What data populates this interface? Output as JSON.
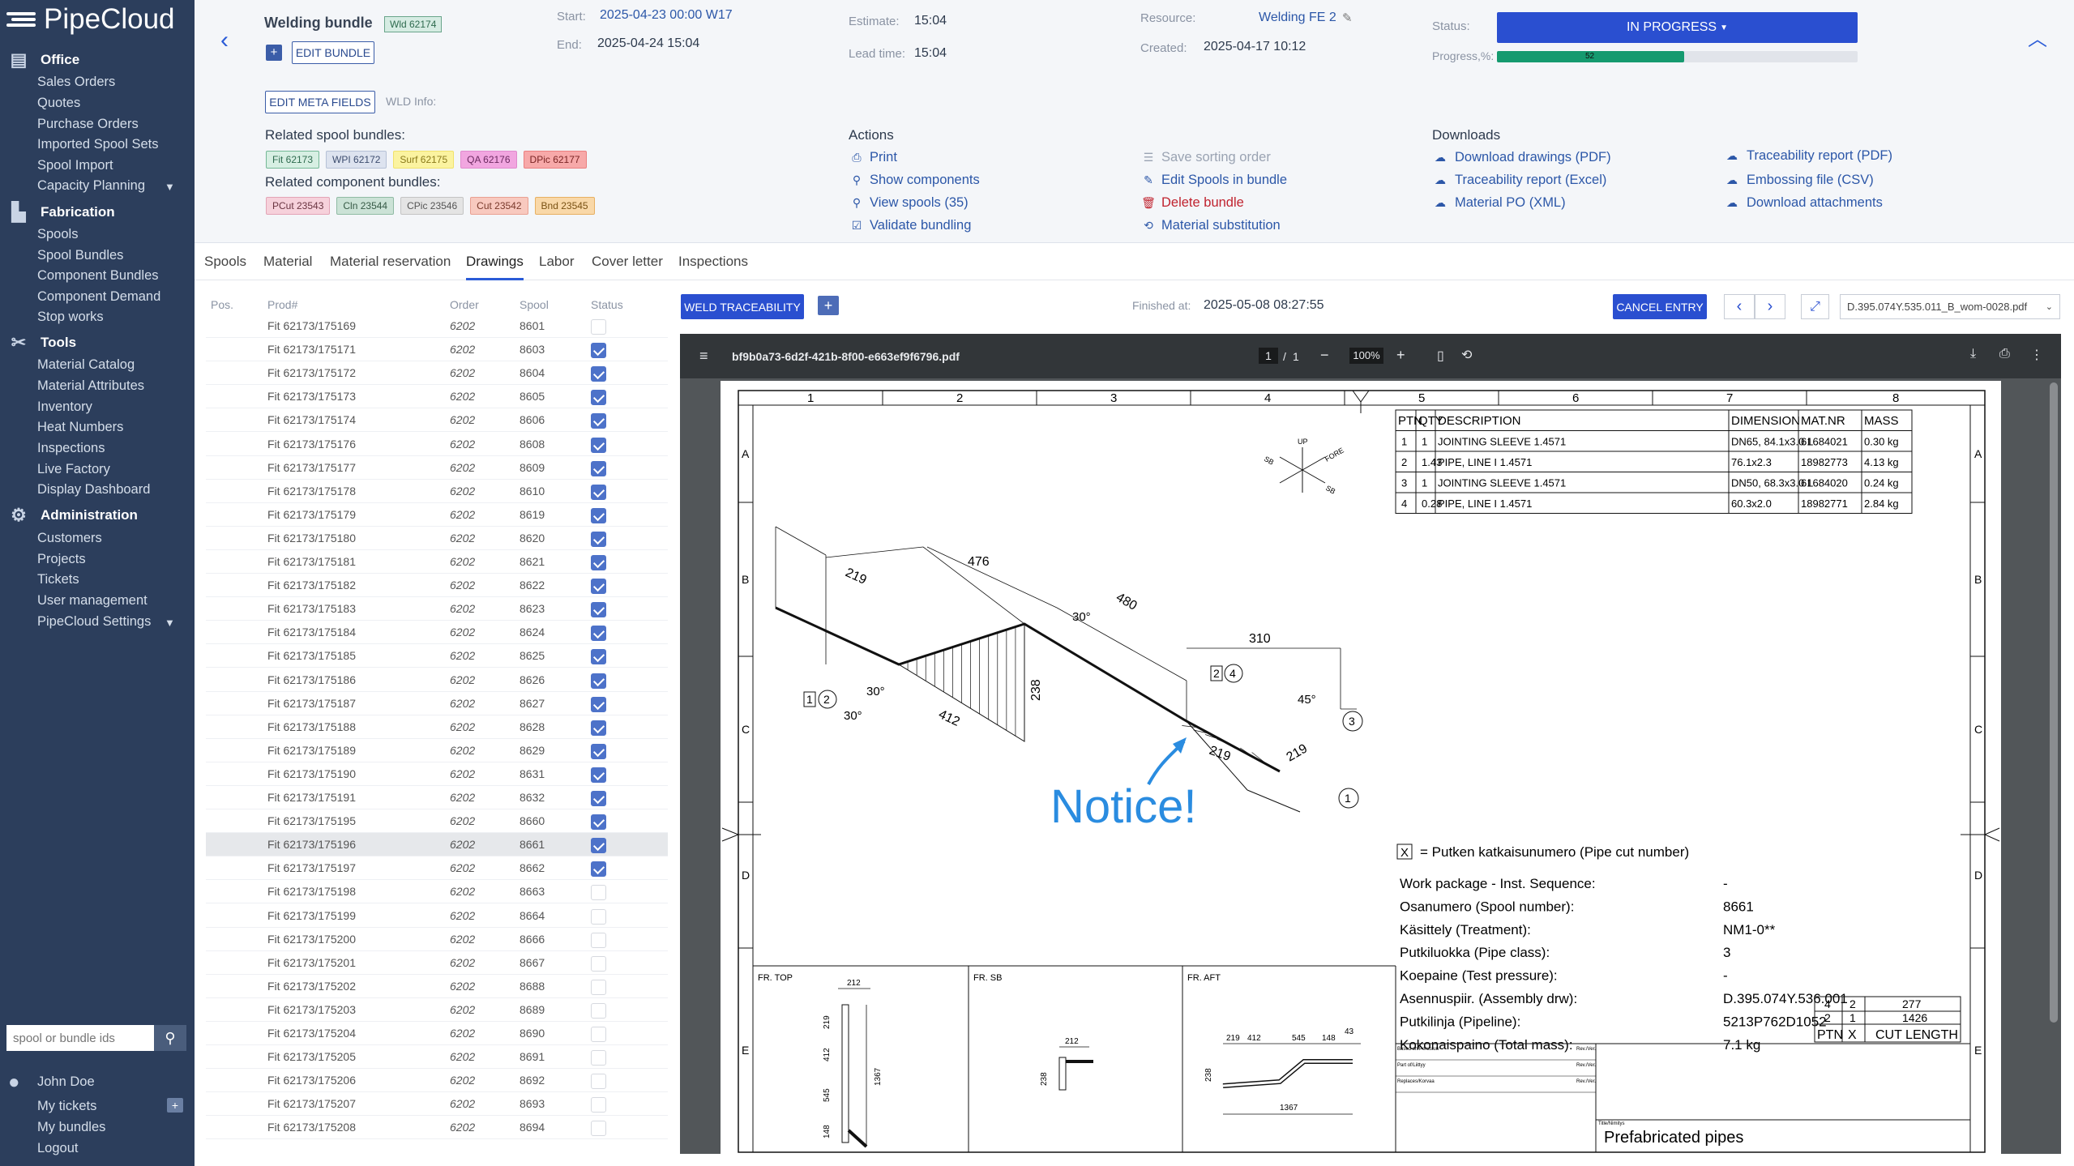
{
  "brand": "PipeCloud",
  "sidebar": {
    "office": {
      "title": "Office",
      "items": [
        "Sales Orders",
        "Quotes",
        "Purchase Orders",
        "Imported Spool Sets",
        "Spool Import",
        "Capacity Planning"
      ]
    },
    "fabrication": {
      "title": "Fabrication",
      "items": [
        "Spools",
        "Spool Bundles",
        "Component Bundles",
        "Component Demand",
        "Stop works"
      ]
    },
    "tools": {
      "title": "Tools",
      "items": [
        "Material Catalog",
        "Material Attributes",
        "Inventory",
        "Heat Numbers",
        "Inspections",
        "Live Factory",
        "Display Dashboard"
      ]
    },
    "administration": {
      "title": "Administration",
      "items": [
        "Customers",
        "Projects",
        "Tickets",
        "User management",
        "PipeCloud Settings"
      ]
    },
    "search_placeholder": "spool or bundle ids",
    "user": {
      "name": "John Doe",
      "links": [
        "My tickets",
        "My bundles",
        "Logout"
      ]
    }
  },
  "header": {
    "title": "Welding bundle",
    "badge": "Wld 62174",
    "edit_bundle": "EDIT BUNDLE",
    "edit_meta": "EDIT META FIELDS",
    "wld_info": "WLD Info:",
    "start_label": "Start:",
    "start": "2025-04-23 00:00 W17",
    "end_label": "End:",
    "end": "2025-04-24 15:04",
    "estimate_label": "Estimate:",
    "estimate": "15:04",
    "lead_label": "Lead time:",
    "lead": "15:04",
    "resource_label": "Resource:",
    "resource": "Welding FE 2",
    "created_label": "Created:",
    "created": "2025-04-17 10:12",
    "status_label": "Status:",
    "status": "IN PROGRESS",
    "progress_label": "Progress,%:",
    "progress": "52",
    "progress_value": 0.52
  },
  "related": {
    "spool_title": "Related spool bundles:",
    "spool_chips": [
      "Fit 62173",
      "WPI 62172",
      "Surf 62175",
      "QA 62176",
      "DPic 62177"
    ],
    "comp_title": "Related component bundles:",
    "comp_chips": [
      "PCut 23543",
      "Cln 23544",
      "CPic 23546",
      "Cut 23542",
      "Bnd 23545"
    ]
  },
  "actions": {
    "title": "Actions",
    "col1": [
      "Print",
      "Show components",
      "View spools (35)",
      "Validate bundling"
    ],
    "col2": [
      "Save sorting order",
      "Edit Spools in bundle",
      "Delete bundle",
      "Material substitution"
    ]
  },
  "downloads": {
    "title": "Downloads",
    "col1": [
      "Download drawings (PDF)",
      "Traceability report (Excel)",
      "Material PO (XML)"
    ],
    "col2": [
      "Traceability report (PDF)",
      "Embossing file (CSV)",
      "Download attachments"
    ]
  },
  "tabs": [
    "Spools",
    "Material",
    "Material reservation",
    "Drawings",
    "Labor",
    "Cover letter",
    "Inspections"
  ],
  "table": {
    "headers": [
      "Pos.",
      "Prod#",
      "Order",
      "Spool",
      "Status"
    ],
    "rows": [
      [
        "Fit 62173/175169",
        "6202",
        "8601",
        false
      ],
      [
        "Fit 62173/175171",
        "6202",
        "8603",
        true
      ],
      [
        "Fit 62173/175172",
        "6202",
        "8604",
        true
      ],
      [
        "Fit 62173/175173",
        "6202",
        "8605",
        true
      ],
      [
        "Fit 62173/175174",
        "6202",
        "8606",
        true
      ],
      [
        "Fit 62173/175176",
        "6202",
        "8608",
        true
      ],
      [
        "Fit 62173/175177",
        "6202",
        "8609",
        true
      ],
      [
        "Fit 62173/175178",
        "6202",
        "8610",
        true
      ],
      [
        "Fit 62173/175179",
        "6202",
        "8619",
        true
      ],
      [
        "Fit 62173/175180",
        "6202",
        "8620",
        true
      ],
      [
        "Fit 62173/175181",
        "6202",
        "8621",
        true
      ],
      [
        "Fit 62173/175182",
        "6202",
        "8622",
        true
      ],
      [
        "Fit 62173/175183",
        "6202",
        "8623",
        true
      ],
      [
        "Fit 62173/175184",
        "6202",
        "8624",
        true
      ],
      [
        "Fit 62173/175185",
        "6202",
        "8625",
        true
      ],
      [
        "Fit 62173/175186",
        "6202",
        "8626",
        true
      ],
      [
        "Fit 62173/175187",
        "6202",
        "8627",
        true
      ],
      [
        "Fit 62173/175188",
        "6202",
        "8628",
        true
      ],
      [
        "Fit 62173/175189",
        "6202",
        "8629",
        true
      ],
      [
        "Fit 62173/175190",
        "6202",
        "8631",
        true
      ],
      [
        "Fit 62173/175191",
        "6202",
        "8632",
        true
      ],
      [
        "Fit 62173/175195",
        "6202",
        "8660",
        true
      ],
      [
        "Fit 62173/175196",
        "6202",
        "8661",
        true
      ],
      [
        "Fit 62173/175197",
        "6202",
        "8662",
        true
      ],
      [
        "Fit 62173/175198",
        "6202",
        "8663",
        false
      ],
      [
        "Fit 62173/175199",
        "6202",
        "8664",
        false
      ],
      [
        "Fit 62173/175200",
        "6202",
        "8666",
        false
      ],
      [
        "Fit 62173/175201",
        "6202",
        "8667",
        false
      ],
      [
        "Fit 62173/175202",
        "6202",
        "8688",
        false
      ],
      [
        "Fit 62173/175203",
        "6202",
        "8689",
        false
      ],
      [
        "Fit 62173/175204",
        "6202",
        "8690",
        false
      ],
      [
        "Fit 62173/175205",
        "6202",
        "8691",
        false
      ],
      [
        "Fit 62173/175206",
        "6202",
        "8692",
        false
      ],
      [
        "Fit 62173/175207",
        "6202",
        "8693",
        false
      ],
      [
        "Fit 62173/175208",
        "6202",
        "8694",
        false
      ]
    ]
  },
  "drawing_toolbar": {
    "weld_traceability": "WELD TRACEABILITY",
    "finished_label": "Finished at:",
    "finished": "2025-05-08 08:27:55",
    "cancel_entry": "CANCEL ENTRY",
    "file_select": "D.395.074Y.535.011_B_wom-0028.pdf"
  },
  "pdf": {
    "filename": "bf9b0a73-6d2f-421b-8f00-e663ef9f6796.pdf",
    "page": "1",
    "page_total": "1",
    "zoom": "100%"
  },
  "drawing": {
    "col_numbers": [
      "1",
      "2",
      "3",
      "4",
      "5",
      "6",
      "7",
      "8"
    ],
    "row_letters": [
      "A",
      "B",
      "C",
      "D",
      "E"
    ],
    "bom_headers": [
      "PTN",
      "QTY",
      "DESCRIPTION",
      "DIMENSION",
      "MAT.NR",
      "MASS"
    ],
    "bom_rows": [
      [
        "1",
        "1",
        "JOINTING SLEEVE 1.4571",
        "DN65, 84.1x3.0 L",
        "61684021",
        "0.30 kg"
      ],
      [
        "2",
        "1.43",
        "PIPE, LINE I 1.4571",
        "76.1x2.3",
        "18982773",
        "4.13 kg"
      ],
      [
        "3",
        "1",
        "JOINTING SLEEVE 1.4571",
        "DN50, 68.3x3.0 L",
        "61684020",
        "0.24 kg"
      ],
      [
        "4",
        "0.28",
        "PIPE, LINE I 1.4571",
        "60.3x2.0",
        "18982771",
        "2.84 kg"
      ]
    ],
    "dims": [
      "219",
      "476",
      "480",
      "310",
      "238",
      "412",
      "219",
      "219",
      "30°",
      "30°",
      "30°",
      "45°"
    ],
    "notice": "Notice!",
    "cut_note": "= Putken katkaisunumero (Pipe cut number)",
    "info_labels": [
      "Work package - Inst. Sequence:",
      "Osanumero    (Spool number):",
      "Käsittely       (Treatment):",
      "Putkiluokka    (Pipe class):",
      "Koepaine    (Test pressure):",
      "Asennuspiir. (Assembly drw):",
      "Putkilinja       (Pipeline):",
      "Kokonaispaino (Total mass):"
    ],
    "info_values": [
      "-",
      "8661",
      "NM1-0**",
      "3",
      "-",
      "D.395.074Y.536.001",
      "5213P762D1052",
      "7.1 kg"
    ],
    "cut_table": [
      [
        "4",
        "2",
        "277"
      ],
      [
        "2",
        "1",
        "1426"
      ]
    ],
    "cut_header": [
      "PTN",
      "X",
      "CUT LENGTH"
    ],
    "views": [
      "FR. TOP",
      "FR. SB",
      "FR. AFT"
    ],
    "view_dims": [
      "212",
      "219",
      "412",
      "545",
      "148",
      "1367",
      "212",
      "238",
      "219",
      "412",
      "545",
      "148",
      "43",
      "238",
      "1367"
    ],
    "title_small": [
      "Based on/Perustuu",
      "Part of/Liittyy",
      "Replaces/Korvaa",
      "Rev./Ver.",
      "Title/Nimitys"
    ],
    "title": "Prefabricated pipes",
    "compass": [
      "UP",
      "FORE",
      "SB"
    ]
  }
}
